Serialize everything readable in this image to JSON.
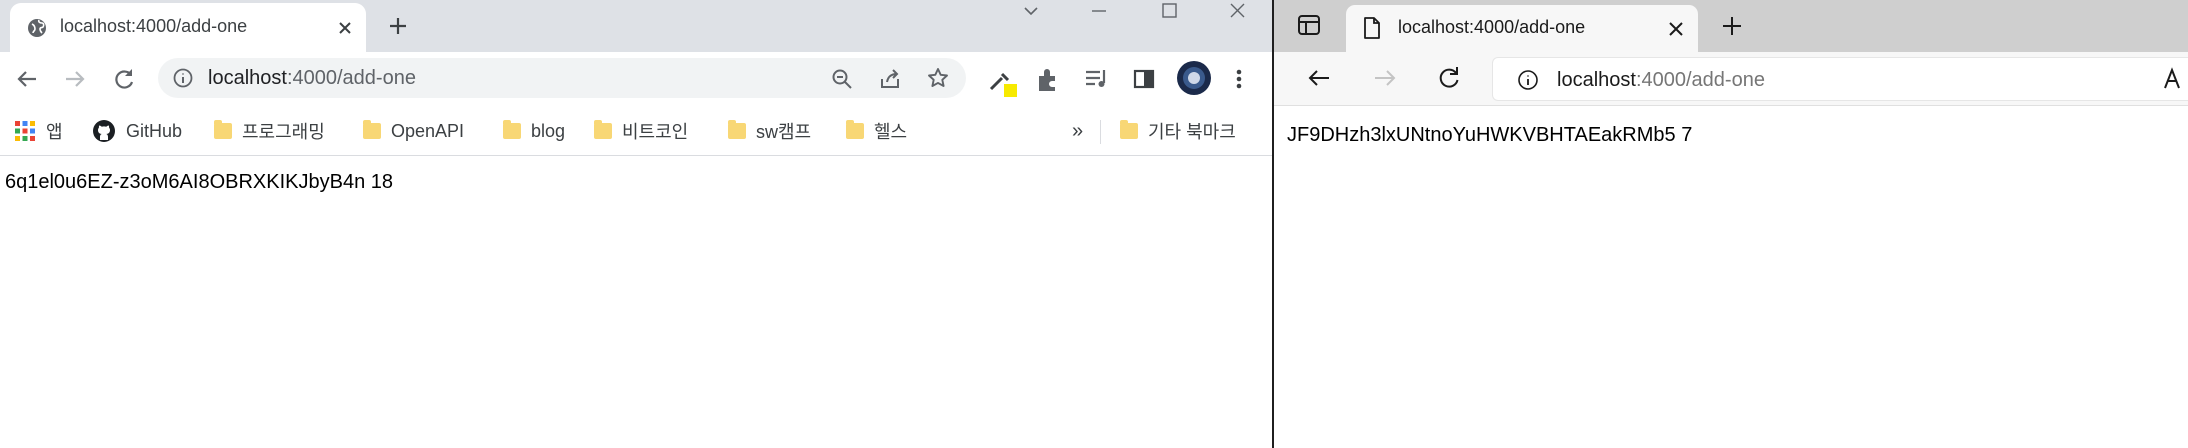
{
  "chrome": {
    "tab": {
      "title": "localhost:4000/add-one"
    },
    "address": {
      "host": "localhost",
      "rest": ":4000/add-one"
    },
    "bookmarks": [
      {
        "label": "앱",
        "icon": "apps-grid-icon"
      },
      {
        "label": "GitHub",
        "icon": "github-icon"
      },
      {
        "label": "프로그래밍",
        "icon": "folder-icon"
      },
      {
        "label": "OpenAPI",
        "icon": "folder-icon"
      },
      {
        "label": "blog",
        "icon": "folder-icon"
      },
      {
        "label": "비트코인",
        "icon": "folder-icon"
      },
      {
        "label": "sw캠프",
        "icon": "folder-icon"
      },
      {
        "label": "헬스",
        "icon": "folder-icon"
      }
    ],
    "bookmarks_overflow": "»",
    "other_bookmarks": "기타 북마크",
    "page_text": "6q1el0u6EZ-z3oM6AI8OBRXKIKJbyB4n 18"
  },
  "edge": {
    "tab": {
      "title": "localhost:4000/add-one"
    },
    "address": {
      "host": "localhost",
      "rest": ":4000/add-one"
    },
    "page_text": "JF9DHzh3lxUNtnoYuHWKVBHTAEakRMb5 7"
  },
  "colors": {
    "chrome_tabstrip": "#dee1e6",
    "edge_tabstrip": "#cfcfcf",
    "folder": "#f8d775",
    "omnibox": "#f1f3f4"
  }
}
